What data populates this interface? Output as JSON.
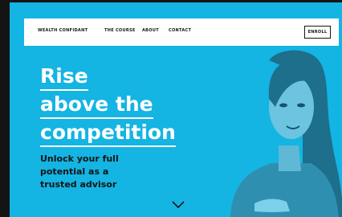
{
  "nav": {
    "brand": "WEALTH CONFIDANT",
    "links": [
      "THE COURSE",
      "ABOUT",
      "CONTACT"
    ],
    "cta": "ENROLL"
  },
  "hero": {
    "headline_lines": [
      "Rise",
      "above the",
      "competition"
    ],
    "subheadline_lines": [
      "Unlock your full",
      "potential as a",
      "trusted advisor"
    ]
  },
  "icons": {
    "scroll": "chevron-down-icon"
  },
  "colors": {
    "background": "#14b4e3",
    "text_light": "#ffffff",
    "text_dark": "#141414"
  }
}
